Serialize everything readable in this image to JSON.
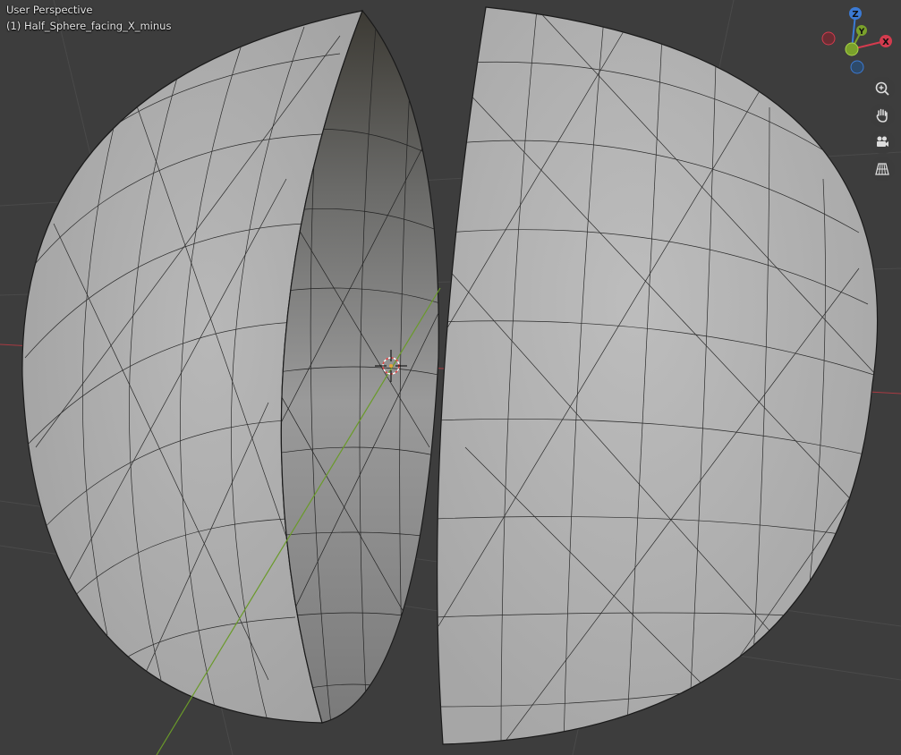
{
  "viewport": {
    "view_name": "User Perspective",
    "object_name": "(1) Half_Sphere_facing_X_minus"
  },
  "gizmo": {
    "x_label": "X",
    "y_label": "Y",
    "z_label": "Z",
    "x_color": "#d43b4e",
    "y_color": "#7aa12b",
    "z_color": "#3b7ad4"
  },
  "nav_buttons": [
    "zoom-icon",
    "hand-pan-icon",
    "camera-icon",
    "grid-perspective-icon"
  ],
  "mesh": {
    "face_color": "#b4b4b4",
    "inner_color": "#8a8a8a",
    "edge_color": "#1a1a1a",
    "vertex_color": "#000000"
  }
}
